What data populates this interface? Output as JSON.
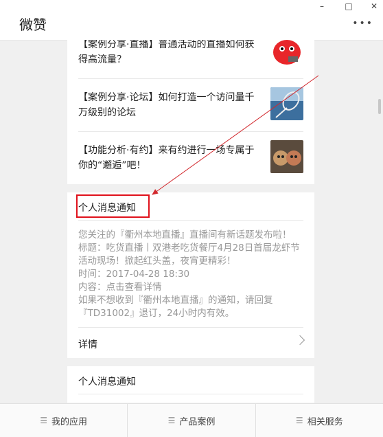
{
  "window": {
    "title": "微赞",
    "controls": {
      "minimize": "–",
      "maximize": "□",
      "close": "✕"
    },
    "more": "•••"
  },
  "articles": [
    {
      "title": "【案例分享·直播】普通活动的直播如何获得高流量？",
      "thumb_icon": "red-mascot-image"
    },
    {
      "title": "【案例分享·论坛】如何打造一个访问量千万级别的论坛",
      "thumb_icon": "badminton-image"
    },
    {
      "title": "【功能分析·有约】来有约进行一场专属于你的“邂逅”吧！",
      "thumb_icon": "apples-image"
    }
  ],
  "notification": {
    "title": "个人消息通知",
    "lines": [
      "您关注的『衢州本地直播』直播间有新话题发布啦！",
      "标题：吃货直播丨双港老吃货餐厅4月28日首届龙虾节活动现场！掀起红头盖，夜宵更精彩！",
      "时间：2017-04-28 18:30",
      "内容：点击查看详情",
      "如果不想收到『衢州本地直播』的通知，请回复『TD31002』退订，24小时内有效。"
    ],
    "detail_label": "详情"
  },
  "notification2": {
    "title": "个人消息通知"
  },
  "bottom_tabs": [
    "我的应用",
    "产品案例",
    "相关服务"
  ],
  "accent_colors": {
    "highlight": "#e0111b",
    "arrow": "#d2282d"
  }
}
